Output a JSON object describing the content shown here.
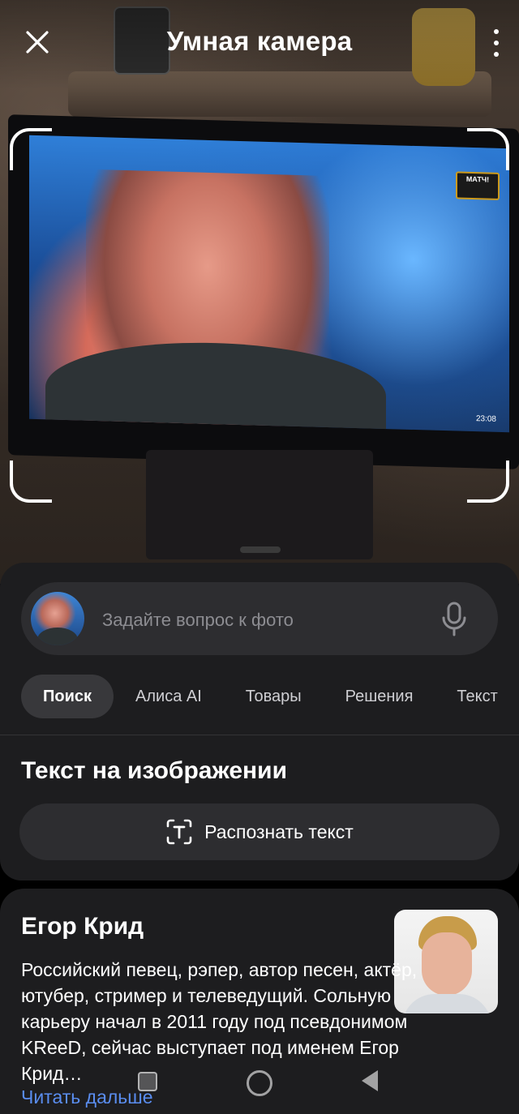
{
  "header": {
    "title": "Умная камера"
  },
  "tv": {
    "channel_logo": "МАТЧ!",
    "clock": "23:08"
  },
  "ask": {
    "placeholder": "Задайте вопрос к фото"
  },
  "tabs": [
    {
      "label": "Поиск",
      "active": true
    },
    {
      "label": "Алиса AI",
      "active": false
    },
    {
      "label": "Товары",
      "active": false
    },
    {
      "label": "Решения",
      "active": false
    },
    {
      "label": "Текст",
      "active": false
    }
  ],
  "text_section": {
    "title": "Текст на изображении",
    "recognize_label": "Распознать текст"
  },
  "person_card": {
    "name": "Егор Крид",
    "description": "Российский певец, рэпер, автор песен, актёр, ютубер, стример и телеведущий. Сольную карьеру начал в 2011 году под псевдонимом KReeD, сейчас выступает под именем Егор Крид…",
    "read_more": "Читать дальше"
  },
  "colors": {
    "sheet_bg": "#1d1d1f",
    "pill_bg": "#2d2d30",
    "link": "#5a8df0"
  }
}
